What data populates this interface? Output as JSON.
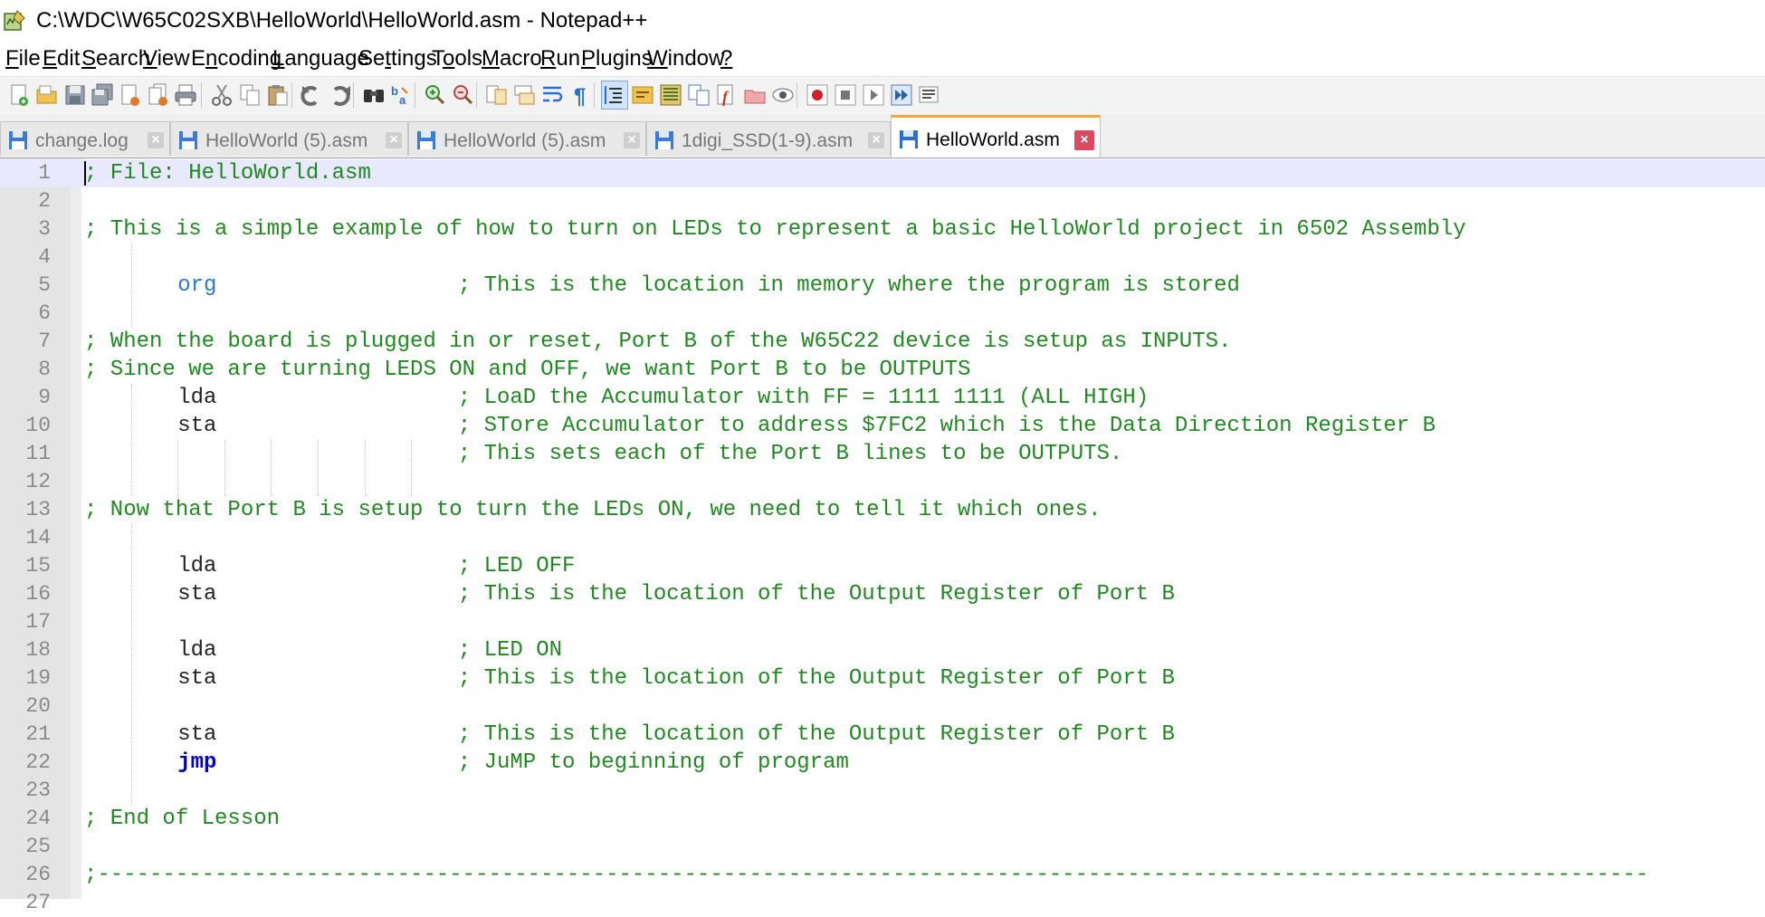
{
  "window": {
    "title": "C:\\WDC\\W65C02SXB\\HelloWorld\\HelloWorld.asm - Notepad++"
  },
  "menu": {
    "items": [
      {
        "label": "File",
        "u": "F"
      },
      {
        "label": "Edit",
        "u": "E"
      },
      {
        "label": "Search",
        "u": "S"
      },
      {
        "label": "View",
        "u": "V"
      },
      {
        "label": "Encoding",
        "u": "n"
      },
      {
        "label": "Language",
        "u": "L"
      },
      {
        "label": "Settings",
        "u": "t"
      },
      {
        "label": "Tools",
        "u": "o"
      },
      {
        "label": "Macro",
        "u": "M"
      },
      {
        "label": "Run",
        "u": "R"
      },
      {
        "label": "Plugins",
        "u": "P"
      },
      {
        "label": "Window",
        "u": "W"
      },
      {
        "label": "?",
        "u": "?"
      }
    ]
  },
  "toolbar": {
    "buttons": [
      "new-file-icon",
      "open-file-icon",
      "save-icon",
      "save-all-icon",
      "close-icon",
      "close-all-icon",
      "print-icon",
      "cut-icon",
      "copy-icon",
      "paste-icon",
      "undo-icon",
      "redo-icon",
      "find-icon",
      "replace-icon",
      "zoom-in-icon",
      "zoom-out-icon",
      "sync-vertical-icon",
      "sync-horizontal-icon",
      "word-wrap-icon",
      "show-all-chars-icon",
      "indent-guide-icon",
      "user-language-icon",
      "document-map-icon",
      "document-list-icon",
      "function-list-icon",
      "folder-workspace-icon",
      "monitoring-icon",
      "record-macro-icon",
      "stop-macro-icon",
      "play-macro-icon",
      "run-macro-multiple-icon",
      "save-macro-icon"
    ]
  },
  "tabs": [
    {
      "label": "change.log",
      "active": false
    },
    {
      "label": "HelloWorld (5).asm",
      "active": false
    },
    {
      "label": "HelloWorld (5).asm",
      "active": false
    },
    {
      "label": "1digi_SSD(1-9).asm",
      "active": false
    },
    {
      "label": "HelloWorld.asm",
      "active": true
    }
  ],
  "editor": {
    "current_line": 1,
    "lines": [
      {
        "n": "1",
        "ins": "",
        "ins_type": "",
        "comment": "; File: HelloWorld.asm",
        "comment_pos": "start"
      },
      {
        "n": "2",
        "ins": "",
        "ins_type": "",
        "comment": "",
        "comment_pos": "start"
      },
      {
        "n": "3",
        "ins": "",
        "ins_type": "",
        "comment": "; This is a simple example of how to turn on LEDs to represent a basic HelloWorld project in 6502 Assembly",
        "comment_pos": "start"
      },
      {
        "n": "4",
        "ins": "",
        "ins_type": "",
        "comment": "",
        "comment_pos": "start"
      },
      {
        "n": "5",
        "ins": "org",
        "ins_type": "dir",
        "comment": "; This is the location in memory where the program is stored",
        "comment_pos": "code"
      },
      {
        "n": "6",
        "ins": "",
        "ins_type": "",
        "comment": "",
        "comment_pos": "start"
      },
      {
        "n": "7",
        "ins": "",
        "ins_type": "",
        "comment": "; When the board is plugged in or reset, Port B of the W65C22 device is setup as INPUTS.",
        "comment_pos": "start"
      },
      {
        "n": "8",
        "ins": "",
        "ins_type": "",
        "comment": "; Since we are turning LEDS ON and OFF, we want Port B to be OUTPUTS",
        "comment_pos": "start"
      },
      {
        "n": "9",
        "ins": "lda",
        "ins_type": "op",
        "comment": "; LoaD the Accumulator with FF = 1111 1111 (ALL HIGH)",
        "comment_pos": "code"
      },
      {
        "n": "10",
        "ins": "sta",
        "ins_type": "op",
        "comment": "; STore Accumulator to address $7FC2 which is the Data Direction Register B",
        "comment_pos": "code"
      },
      {
        "n": "11",
        "ins": "",
        "ins_type": "",
        "comment": "; This sets each of the Port B lines to be OUTPUTS.",
        "comment_pos": "code"
      },
      {
        "n": "12",
        "ins": "",
        "ins_type": "",
        "comment": "",
        "comment_pos": "start"
      },
      {
        "n": "13",
        "ins": "",
        "ins_type": "",
        "comment": "; Now that Port B is setup to turn the LEDs ON, we need to tell it which ones.",
        "comment_pos": "start"
      },
      {
        "n": "14",
        "ins": "",
        "ins_type": "",
        "comment": "",
        "comment_pos": "start"
      },
      {
        "n": "15",
        "ins": "lda",
        "ins_type": "op",
        "comment": "; LED OFF",
        "comment_pos": "code"
      },
      {
        "n": "16",
        "ins": "sta",
        "ins_type": "op",
        "comment": "; This is the location of the Output Register of Port B",
        "comment_pos": "code"
      },
      {
        "n": "17",
        "ins": "",
        "ins_type": "",
        "comment": "",
        "comment_pos": "start"
      },
      {
        "n": "18",
        "ins": "lda",
        "ins_type": "op",
        "comment": "; LED ON",
        "comment_pos": "code"
      },
      {
        "n": "19",
        "ins": "sta",
        "ins_type": "op",
        "comment": "; This is the location of the Output Register of Port B",
        "comment_pos": "code"
      },
      {
        "n": "20",
        "ins": "",
        "ins_type": "",
        "comment": "",
        "comment_pos": "start"
      },
      {
        "n": "21",
        "ins": "sta",
        "ins_type": "op",
        "comment": "; This is the location of the Output Register of Port B",
        "comment_pos": "code"
      },
      {
        "n": "22",
        "ins": "jmp",
        "ins_type": "jmp",
        "comment": "; JuMP to beginning of program",
        "comment_pos": "code"
      },
      {
        "n": "23",
        "ins": "",
        "ins_type": "",
        "comment": "",
        "comment_pos": "start"
      },
      {
        "n": "24",
        "ins": "",
        "ins_type": "",
        "comment": "; End of Lesson",
        "comment_pos": "start"
      },
      {
        "n": "25",
        "ins": "",
        "ins_type": "",
        "comment": "",
        "comment_pos": "start"
      },
      {
        "n": "26",
        "ins": "",
        "ins_type": "",
        "comment": ";-----------------------------------------------------------------------------------------------------------------------",
        "comment_pos": "start"
      },
      {
        "n": "27",
        "ins": "",
        "ins_type": "",
        "comment": "",
        "comment_pos": "start"
      }
    ]
  },
  "colors": {
    "comment": "#1f8a1f",
    "directive": "#2a7ad4",
    "jump": "#0000d0",
    "active_tab_accent": "#f4a73b",
    "current_line_bg": "#e8e8ff"
  }
}
